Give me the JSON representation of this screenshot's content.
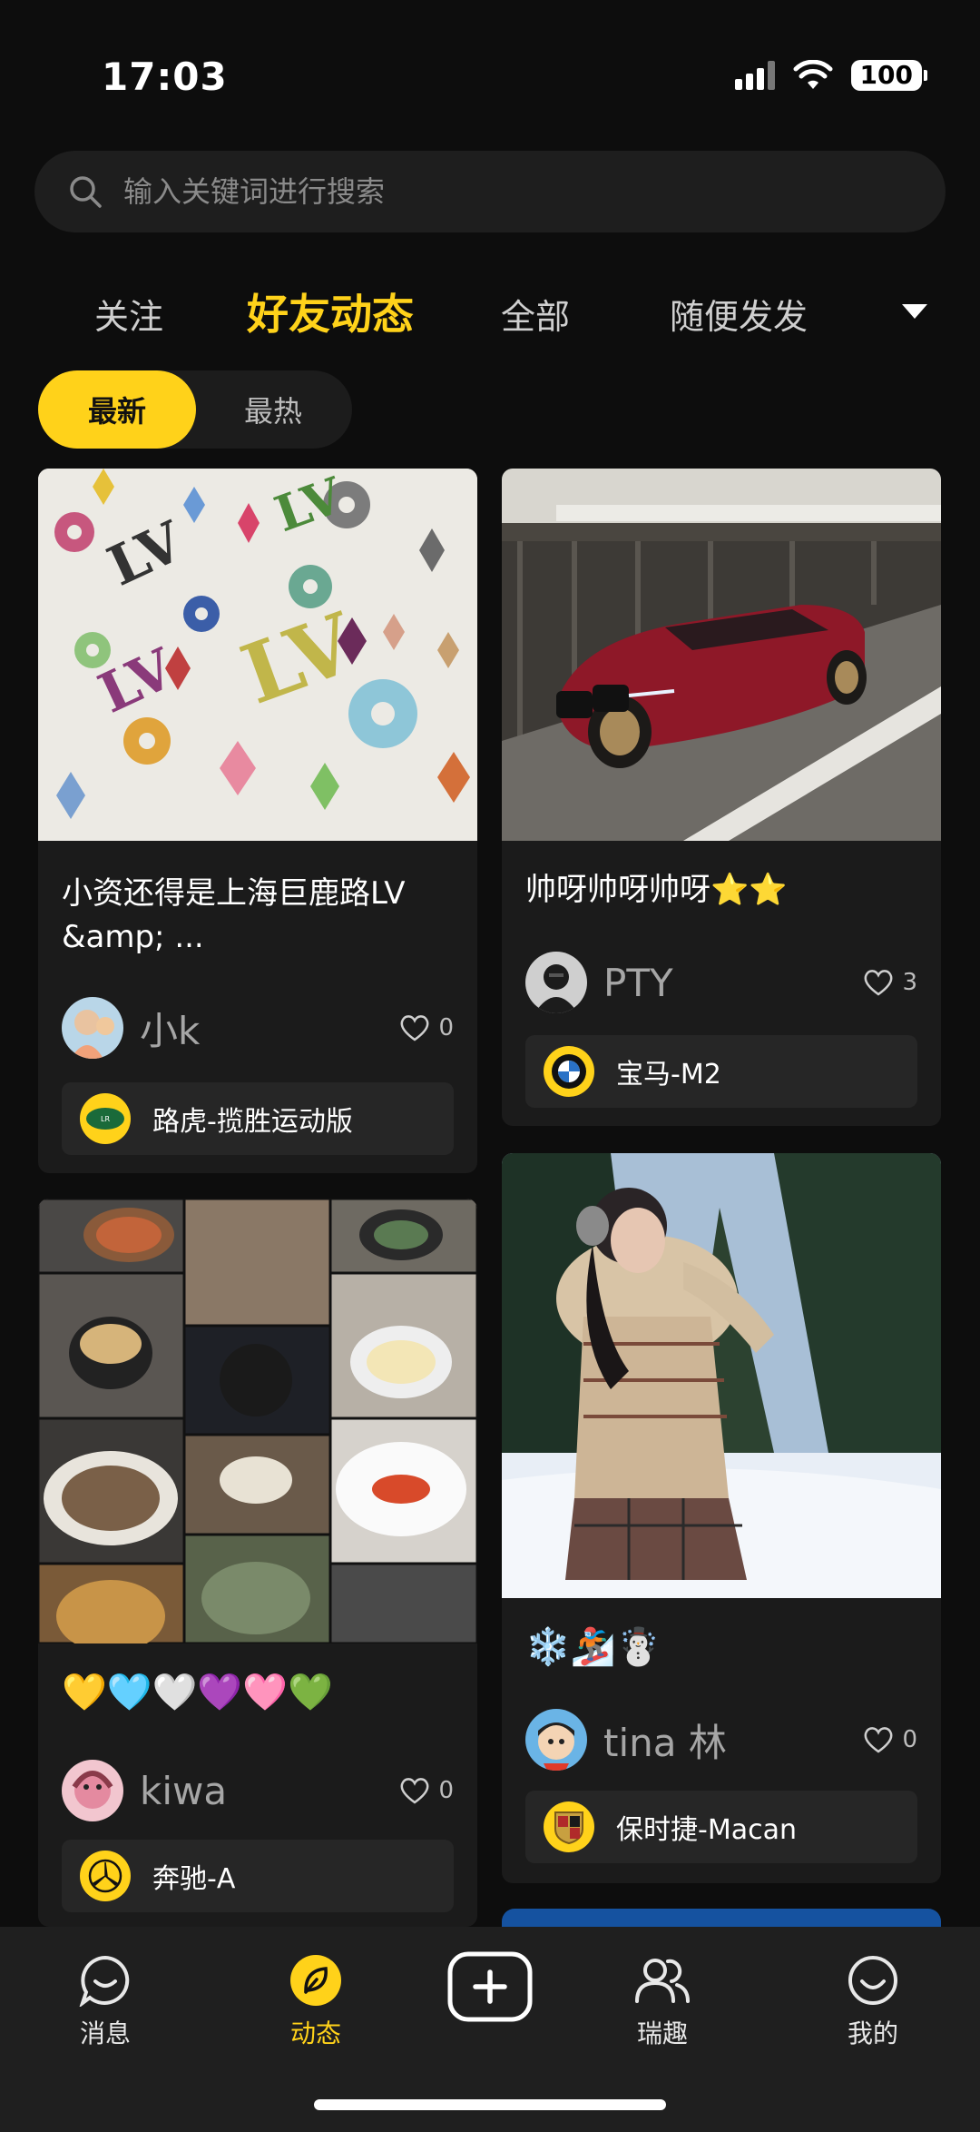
{
  "status_bar": {
    "time": "17:03",
    "battery": "100"
  },
  "search": {
    "placeholder": "输入关键词进行搜索"
  },
  "tabs": [
    {
      "label": "关注",
      "active": false
    },
    {
      "label": "好友动态",
      "active": true
    },
    {
      "label": "全部",
      "active": false
    },
    {
      "label": "随便发发",
      "active": false
    }
  ],
  "sort": [
    {
      "label": "最新",
      "active": true
    },
    {
      "label": "最热",
      "active": false
    }
  ],
  "posts": [
    {
      "title": "小资还得是上海巨鹿路LV &amp; ...",
      "author": "小k",
      "likes": "0",
      "car": "路虎-揽胜运动版"
    },
    {
      "title": "帅呀帅呀帅呀⭐⭐",
      "author": "PTY",
      "likes": "3",
      "car": "宝马-M2"
    },
    {
      "title": "💛🩵🤍💜🩷💚",
      "author": "kiwa",
      "likes": "0",
      "car": "奔驰-A"
    },
    {
      "title": "❄️🏂☃️",
      "author": "tina 林",
      "likes": "0",
      "car": "保时捷-Macan"
    }
  ],
  "nav": [
    {
      "label": "消息",
      "icon": "chat-bubble-icon",
      "active": false
    },
    {
      "label": "动态",
      "icon": "leaf-icon",
      "active": true
    },
    {
      "label": "",
      "icon": "add-post-icon",
      "active": false
    },
    {
      "label": "瑞趣",
      "icon": "people-icon",
      "active": false
    },
    {
      "label": "我的",
      "icon": "smiley-icon",
      "active": false
    }
  ],
  "colors": {
    "accent": "#ffd21a",
    "background": "#0d0d0d",
    "card": "#1b1b1b"
  }
}
